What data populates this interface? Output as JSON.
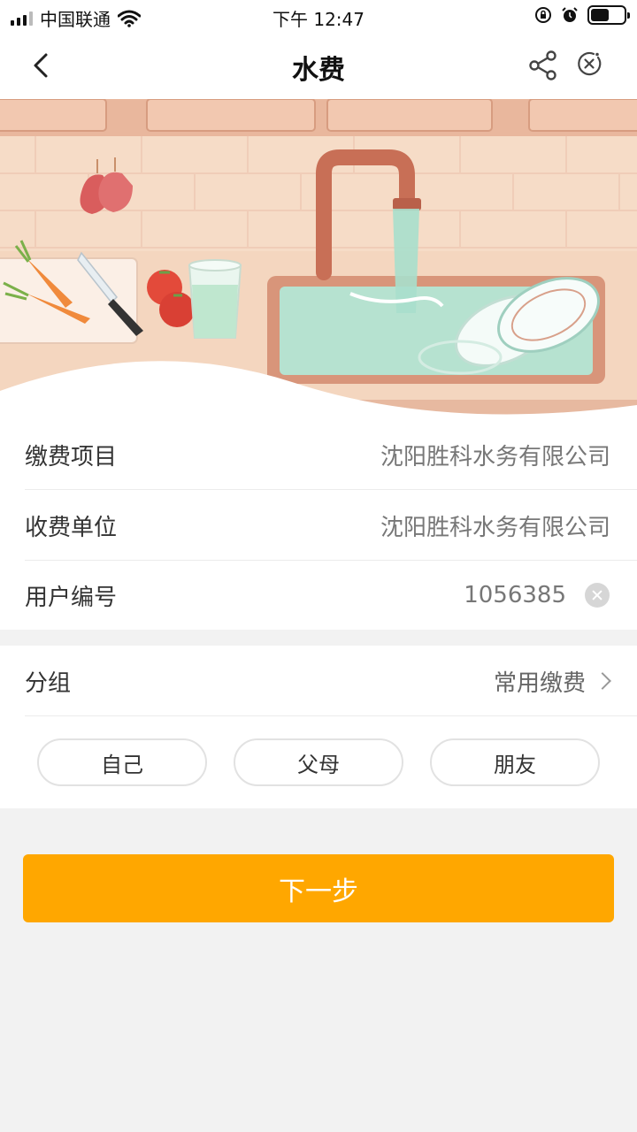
{
  "status_bar": {
    "carrier": "中国联通",
    "time": "下午 12:47"
  },
  "nav": {
    "title": "水费"
  },
  "info": {
    "item_label": "缴费项目",
    "item_value": "沈阳胜科水务有限公司",
    "unit_label": "收费单位",
    "unit_value": "沈阳胜科水务有限公司",
    "account_label": "用户编号",
    "account_value": "1056385"
  },
  "group": {
    "label": "分组",
    "value": "常用缴费",
    "chips": [
      "自己",
      "父母",
      "朋友"
    ]
  },
  "next_button": "下一步",
  "colors": {
    "accent": "#ffa700"
  }
}
